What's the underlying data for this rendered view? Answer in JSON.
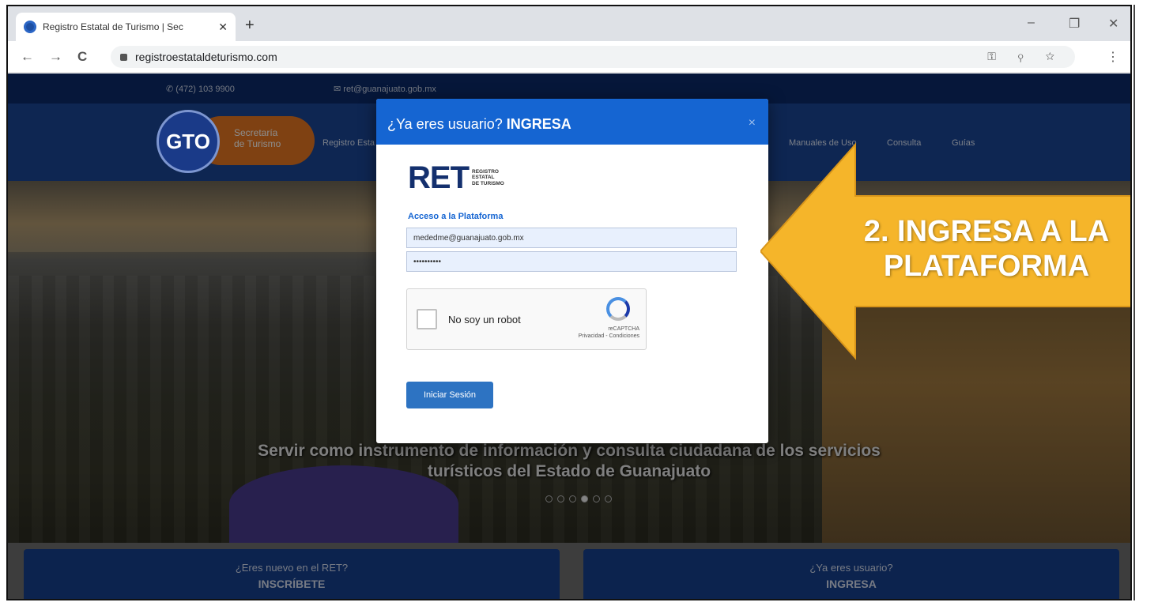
{
  "browser": {
    "tab_title": "Registro Estatal de Turismo | Sec",
    "tab_close": "✕",
    "new_tab": "+",
    "url": "registroestataldeturismo.com",
    "back": "←",
    "forward": "→",
    "reload": "C",
    "minimize": "–",
    "maximize": "❐",
    "close": "✕",
    "omni_icons": "⚿ ⚲ ☆",
    "menu": "⋮"
  },
  "site": {
    "phone": "(472) 103 9900",
    "email": "ret@guanajuato.gob.mx",
    "logo_initials": "GTO",
    "logo_text_1": "Secretaría",
    "logo_text_2": "de Turismo",
    "nav": [
      "Registro Esta",
      "Manuales de Uso",
      "Consulta",
      "Guías"
    ],
    "hero_caption_1": "Servir como instrumento de información y consulta ciudadana de los servicios",
    "hero_caption_2": "turísticos del Estado de Guanajuato",
    "cta_left_q": "¿Eres nuevo en el RET?",
    "cta_left_a": "INSCRÍBETE",
    "cta_right_q": "¿Ya eres usuario?",
    "cta_right_a": "INGRESA"
  },
  "modal": {
    "title_prefix": "¿Ya eres usuario? ",
    "title_bold": "INGRESA",
    "close": "×",
    "ret_logo": "RET",
    "ret_sub_1": "REGISTRO",
    "ret_sub_2": "ESTATAL",
    "ret_sub_3": "DE TURISMO",
    "access_label": "Acceso a la Plataforma",
    "email_value": "mededme@guanajuato.gob.mx",
    "password_value": "••••••••••",
    "captcha_label": "No soy un robot",
    "captcha_brand": "reCAPTCHA",
    "captcha_links": "Privacidad - Condiciones",
    "login_button": "Iniciar Sesión"
  },
  "callout": {
    "line1": "2. INGRESA A LA",
    "line2": "PLATAFORMA",
    "color": "#f5b52a"
  }
}
